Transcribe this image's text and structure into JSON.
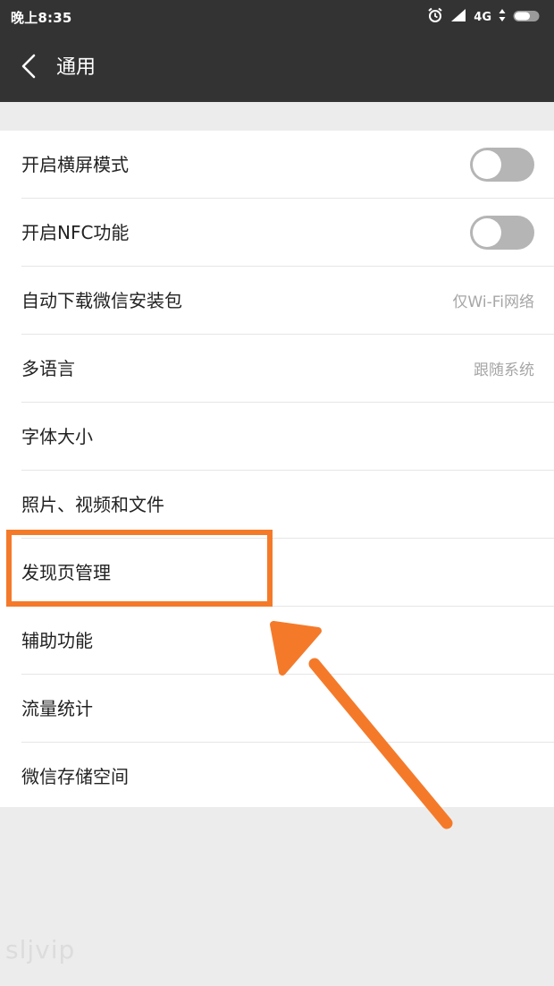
{
  "status_bar": {
    "time": "晚上8:35",
    "network": "4G",
    "icons": [
      "alarm-icon",
      "signal-icon",
      "data-arrows-icon",
      "battery-icon"
    ]
  },
  "app_bar": {
    "title": "通用",
    "back_icon": "chevron-left-icon"
  },
  "settings": {
    "items": [
      {
        "label": "开启横屏模式",
        "control": "toggle",
        "on": false
      },
      {
        "label": "开启NFC功能",
        "control": "toggle",
        "on": false
      },
      {
        "label": "自动下载微信安装包",
        "value": "仅Wi-Fi网络"
      },
      {
        "label": "多语言",
        "value": "跟随系统"
      },
      {
        "label": "字体大小"
      },
      {
        "label": "照片、视频和文件"
      },
      {
        "label": "发现页管理",
        "highlighted": true
      },
      {
        "label": "辅助功能"
      },
      {
        "label": "流量统计"
      },
      {
        "label": "微信存储空间"
      }
    ]
  },
  "annotation": {
    "color": "#f47a2a",
    "target": "发现页管理"
  },
  "watermark": "sljvip",
  "colors": {
    "header": "#333333",
    "background": "#ececec",
    "accent": "#f47a2a",
    "toggle_off": "#b5b5b5"
  }
}
